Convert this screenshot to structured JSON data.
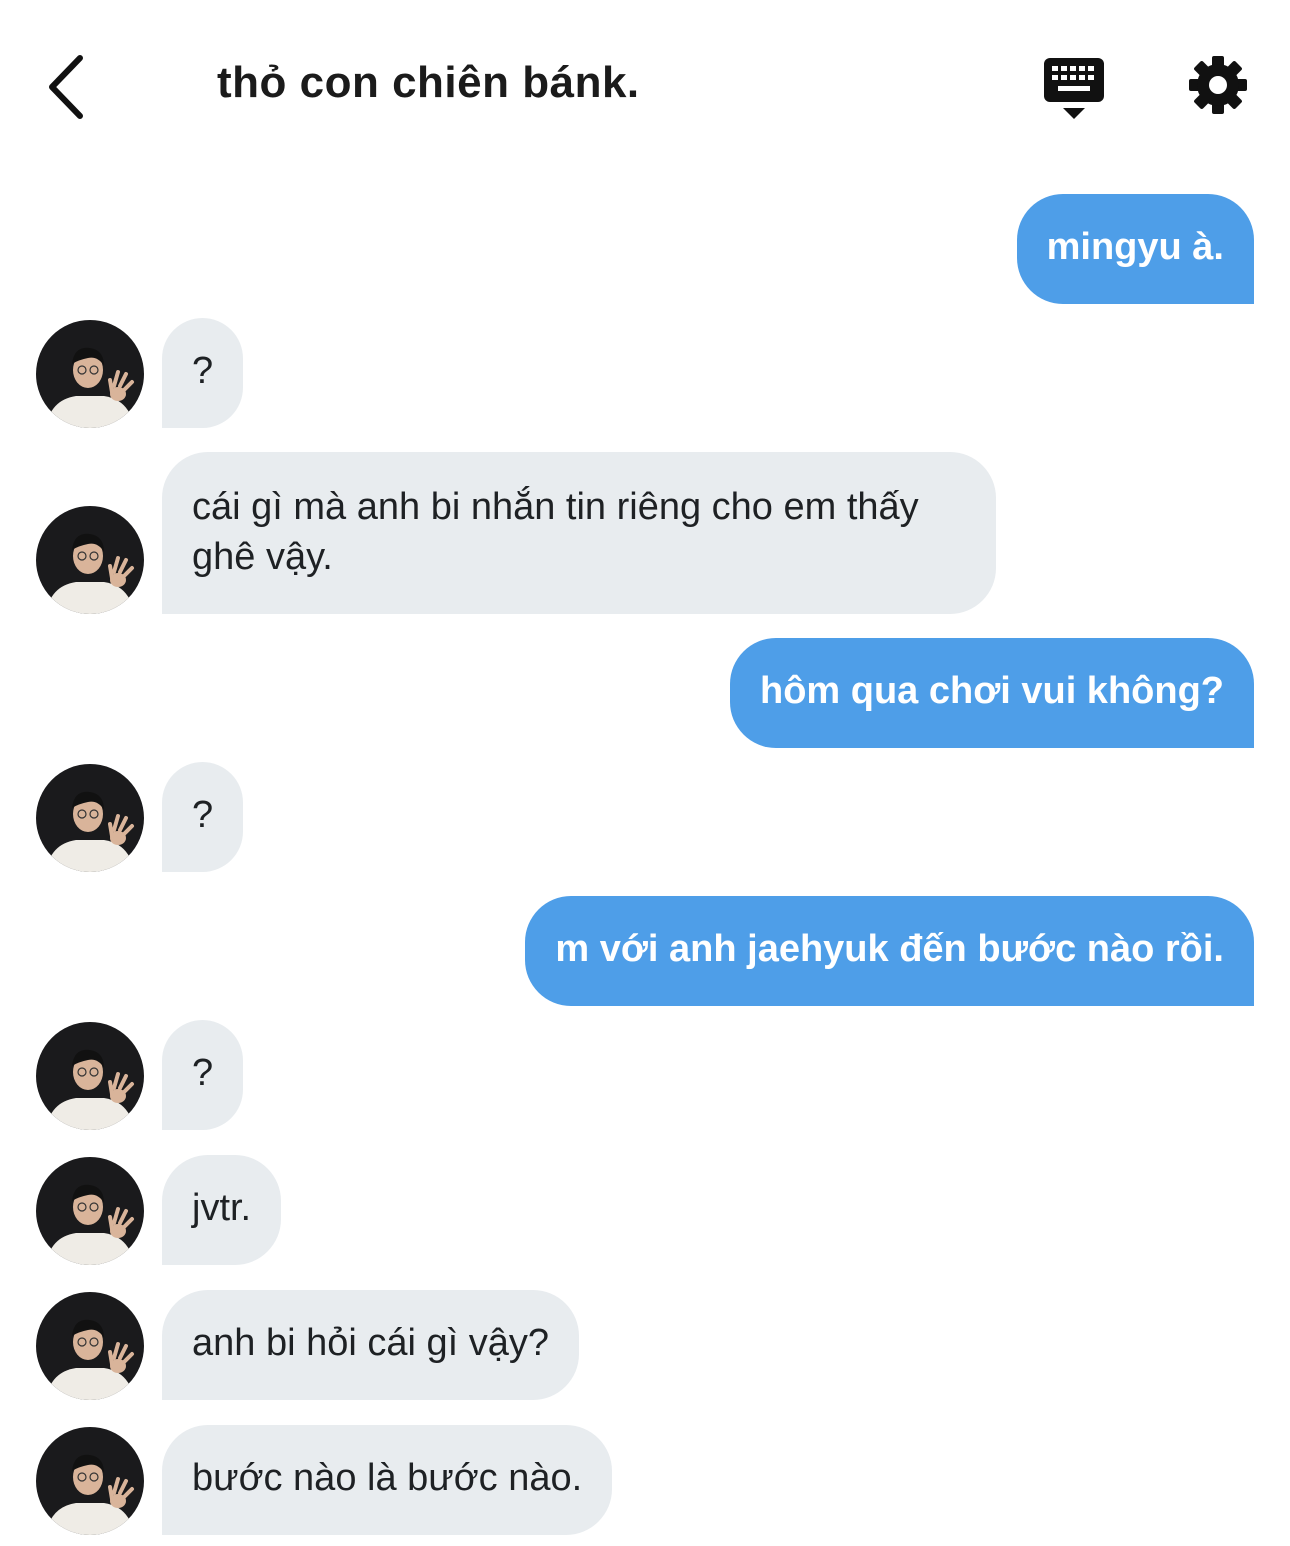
{
  "header": {
    "title": "thỏ con chiên bánk."
  },
  "colors": {
    "outgoing_bubble": "#4e9ee8",
    "incoming_bubble": "#e8ecef",
    "text_dark": "#1e2124"
  },
  "icons": {
    "back": "chevron-left-icon",
    "keyboard": "keyboard-hide-icon",
    "settings": "gear-icon"
  },
  "messages": [
    {
      "direction": "out",
      "text": "mingyu à."
    },
    {
      "direction": "in",
      "text": "?"
    },
    {
      "direction": "in",
      "text": "cái gì mà anh bi nhắn tin riêng cho em thấy ghê vậy."
    },
    {
      "direction": "out",
      "text": "hôm qua chơi vui không?"
    },
    {
      "direction": "in",
      "text": "?"
    },
    {
      "direction": "out",
      "text": "m với anh jaehyuk đến bước nào rồi."
    },
    {
      "direction": "in",
      "text": "?"
    },
    {
      "direction": "in",
      "text": "jvtr."
    },
    {
      "direction": "in",
      "text": "anh bi hỏi cái gì vậy?"
    },
    {
      "direction": "in",
      "text": "bước nào là bước nào."
    }
  ]
}
